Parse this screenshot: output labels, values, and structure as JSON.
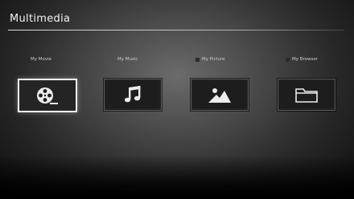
{
  "header": {
    "title": "Multimedia"
  },
  "items": [
    {
      "label": "My Movie",
      "icon": "film-reel-icon",
      "selected": true,
      "marker": false
    },
    {
      "label": "My Music",
      "icon": "music-note-icon",
      "selected": false,
      "marker": false
    },
    {
      "label": "My Picture",
      "icon": "picture-icon",
      "selected": false,
      "marker": true
    },
    {
      "label": "My Browser",
      "icon": "folder-icon",
      "selected": false,
      "marker": true
    }
  ],
  "colors": {
    "selected_border": "#f5f5f5",
    "tile_background": "#1d1d1d",
    "text": "#f2f2f2"
  }
}
